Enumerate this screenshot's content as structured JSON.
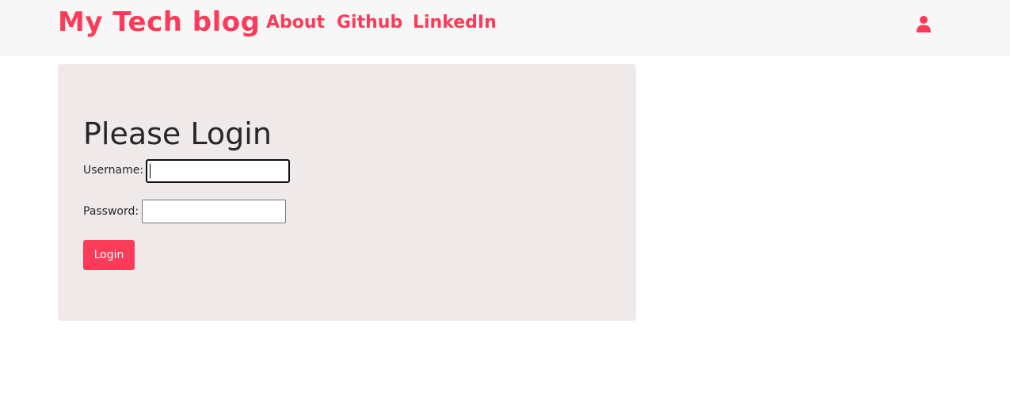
{
  "navbar": {
    "brand": "My Tech blog",
    "links": [
      {
        "label": "About"
      },
      {
        "label": "Github"
      },
      {
        "label": "LinkedIn"
      }
    ],
    "user_icon": "user-icon"
  },
  "login": {
    "title": "Please Login",
    "username_label": "Username:",
    "username_value": "",
    "password_label": "Password:",
    "password_value": "",
    "button_label": "Login"
  },
  "colors": {
    "accent": "#fc3b58",
    "navbar_bg": "#f8f7f8",
    "card_bg": "#efe9ea",
    "text": "#2a2526"
  }
}
